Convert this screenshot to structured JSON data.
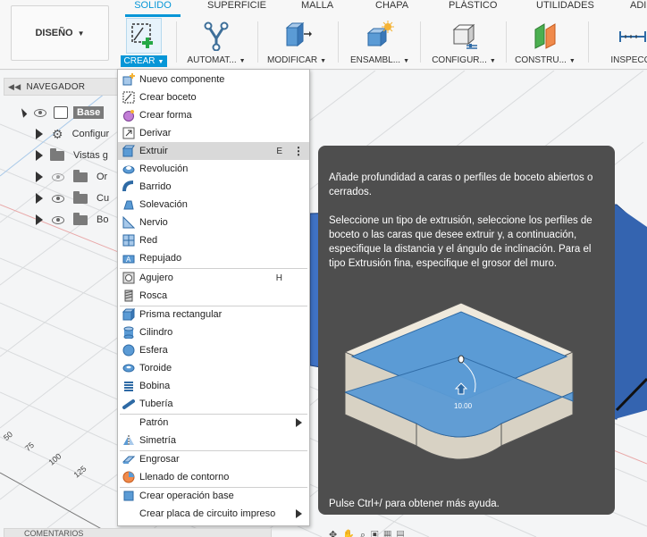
{
  "toolbar": {
    "design_label": "DISEÑO",
    "tabs": [
      "SOLIDO",
      "SUPERFICIE",
      "MALLA",
      "CHAPA",
      "PLÁSTICO",
      "UTILIDADES",
      "ADI"
    ],
    "tools": {
      "crear": "CREAR",
      "automat": "AUTOMAT...",
      "modificar": "MODIFICAR",
      "ensambl": "ENSAMBL...",
      "configu": "CONFIGUR...",
      "constru": "CONSTRU...",
      "inspecc": "INSPECCI"
    }
  },
  "navigator": {
    "title": "NAVEGADOR",
    "items": [
      "Base",
      "Configur",
      "Vistas g",
      "Or",
      "Cu",
      "Bo"
    ]
  },
  "menu": {
    "items": [
      {
        "label": "Nuevo componente",
        "icon": "new-component-icon"
      },
      {
        "label": "Crear boceto",
        "icon": "sketch-icon"
      },
      {
        "label": "Crear forma",
        "icon": "form-icon"
      },
      {
        "label": "Derivar",
        "icon": "derive-icon"
      },
      {
        "label": "Extruir",
        "icon": "extrude-icon",
        "shortcut": "E",
        "highlighted": true
      },
      {
        "label": "Revolución",
        "icon": "revolve-icon"
      },
      {
        "label": "Barrido",
        "icon": "sweep-icon"
      },
      {
        "label": "Solevación",
        "icon": "loft-icon"
      },
      {
        "label": "Nervio",
        "icon": "rib-icon"
      },
      {
        "label": "Red",
        "icon": "web-icon"
      },
      {
        "label": "Repujado",
        "icon": "emboss-icon"
      },
      {
        "label": "Agujero",
        "icon": "hole-icon",
        "shortcut": "H"
      },
      {
        "label": "Rosca",
        "icon": "thread-icon"
      },
      {
        "label": "Prisma rectangular",
        "icon": "box-icon"
      },
      {
        "label": "Cilindro",
        "icon": "cylinder-icon"
      },
      {
        "label": "Esfera",
        "icon": "sphere-icon"
      },
      {
        "label": "Toroide",
        "icon": "torus-icon"
      },
      {
        "label": "Bobina",
        "icon": "coil-icon"
      },
      {
        "label": "Tubería",
        "icon": "pipe-icon"
      },
      {
        "label": "Patrón",
        "icon": "",
        "submenu": true
      },
      {
        "label": "Simetría",
        "icon": "mirror-icon"
      },
      {
        "label": "Engrosar",
        "icon": "thicken-icon"
      },
      {
        "label": "Llenado de contorno",
        "icon": "boundary-fill-icon"
      },
      {
        "label": "Crear operación base",
        "icon": "base-feature-icon"
      },
      {
        "label": "Crear placa de circuito impreso",
        "icon": "",
        "submenu": true
      }
    ]
  },
  "tooltip": {
    "p1": "Añade profundidad a caras o perfiles de boceto abiertos o cerrados.",
    "p2": "Seleccione un tipo de extrusión, seleccione los perfiles de boceto o las caras que desee extruir y, a continuación, especifique la distancia y el ángulo de inclinación. Para el tipo Extrusión fina, especifique el grosor del muro.",
    "footer": "Pulse Ctrl+/ para obtener más ayuda.",
    "dimension": "10.00"
  },
  "ruler": [
    "50",
    "75",
    "100",
    "125"
  ],
  "bottom": {
    "comments": "COMENTARIOS"
  },
  "colors": {
    "accent": "#0696d7",
    "tooltip_bg": "#4e4e4e",
    "highlight": "#d9d9d9"
  }
}
